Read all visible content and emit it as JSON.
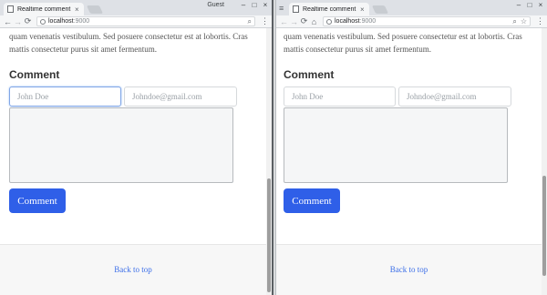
{
  "left": {
    "tab_title": "Realtime comment",
    "guest_label": "Guest",
    "url_host": "localhost",
    "url_port": ":9000"
  },
  "right": {
    "tab_title": "Realtime comment",
    "url_host": "localhost",
    "url_port": ":9000"
  },
  "page": {
    "paragraph": "quam venenatis vestibulum. Sed posuere consectetur est at lobortis. Cras mattis consectetur purus sit amet fermentum.",
    "section_title": "Comment",
    "name_placeholder": "John Doe",
    "email_placeholder": "Johndoe@gmail.com",
    "submit_label": "Comment",
    "back_to_top": "Back to top"
  },
  "icons": {
    "tab_close": "×",
    "back": "←",
    "forward": "→",
    "reload": "⟳",
    "home": "⌂",
    "zoom": "⌕",
    "star": "☆",
    "menu": "⋮",
    "hamburger": "≡",
    "minimize": "–",
    "maximize": "□",
    "close": "×"
  },
  "colors": {
    "accent": "#2f5fe8",
    "link": "#3b6ee8"
  }
}
